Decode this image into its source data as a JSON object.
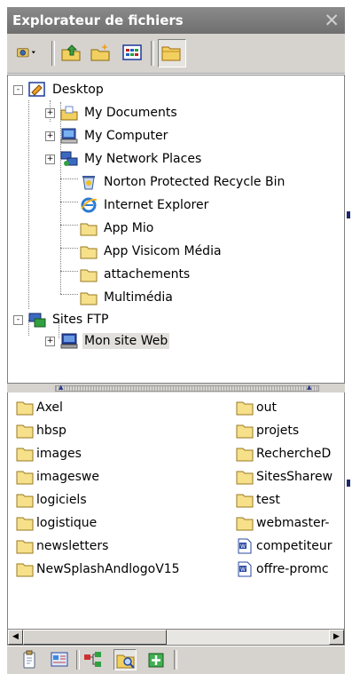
{
  "window": {
    "title": "Explorateur de fichiers",
    "close_glyph": "✕"
  },
  "toolbar": {
    "buttons": [
      {
        "name": "views-dropdown",
        "icon": "camera-icon"
      },
      {
        "name": "up-folder",
        "icon": "up-folder-icon"
      },
      {
        "name": "new-folder",
        "icon": "new-folder-icon"
      },
      {
        "name": "view-mode",
        "icon": "grid-view-icon"
      },
      {
        "name": "folders-toggle",
        "icon": "folder-icon",
        "pressed": true
      }
    ]
  },
  "tree": {
    "nodes": [
      {
        "label": "Desktop",
        "icon": "desktop-icon",
        "expander": "-"
      },
      {
        "label": "My Documents",
        "icon": "my-documents-icon",
        "expander": "+"
      },
      {
        "label": "My Computer",
        "icon": "my-computer-icon",
        "expander": "+"
      },
      {
        "label": "My Network Places",
        "icon": "network-icon",
        "expander": "+"
      },
      {
        "label": "Norton Protected Recycle Bin",
        "icon": "recycle-bin-icon"
      },
      {
        "label": "Internet Explorer",
        "icon": "internet-explorer-icon"
      },
      {
        "label": "App Mio",
        "icon": "folder-icon"
      },
      {
        "label": "App Visicom Média",
        "icon": "folder-icon"
      },
      {
        "label": "attachements",
        "icon": "folder-icon"
      },
      {
        "label": "Multimédia",
        "icon": "folder-icon"
      },
      {
        "label": "Sites FTP",
        "icon": "ftp-sites-icon",
        "expander": "-"
      },
      {
        "label": "Mon site Web",
        "icon": "server-icon",
        "expander": "+",
        "selected": true
      }
    ]
  },
  "file_list": {
    "left_column": [
      {
        "label": "Axel",
        "icon": "folder-icon"
      },
      {
        "label": "hbsp",
        "icon": "folder-icon"
      },
      {
        "label": "images",
        "icon": "folder-icon"
      },
      {
        "label": "imageswe",
        "icon": "folder-icon"
      },
      {
        "label": "logiciels",
        "icon": "folder-icon"
      },
      {
        "label": "logistique",
        "icon": "folder-icon"
      },
      {
        "label": "newsletters",
        "icon": "folder-icon"
      },
      {
        "label": "NewSplashAndlogoV15",
        "icon": "folder-icon"
      }
    ],
    "right_column": [
      {
        "label": "out",
        "icon": "folder-icon"
      },
      {
        "label": "projets",
        "icon": "folder-icon"
      },
      {
        "label": "RechercheD",
        "icon": "folder-icon"
      },
      {
        "label": "SitesSharew",
        "icon": "folder-icon"
      },
      {
        "label": "test",
        "icon": "folder-icon"
      },
      {
        "label": "webmaster-",
        "icon": "folder-icon"
      },
      {
        "label": "competiteur",
        "icon": "word-document-icon"
      },
      {
        "label": "offre-promc",
        "icon": "word-document-icon"
      }
    ]
  },
  "scrollbar": {
    "left_arrow": "◀",
    "right_arrow": "▶",
    "thumb_fraction": 0.47
  },
  "bottom_tabs": [
    {
      "name": "clipboard",
      "icon": "clipboard-icon"
    },
    {
      "name": "snippets",
      "icon": "snippets-icon"
    },
    {
      "name": "site-map",
      "icon": "site-map-icon"
    },
    {
      "name": "file-explorer",
      "icon": "folder-search-icon",
      "active": true
    },
    {
      "name": "add-ons",
      "icon": "plugin-icon"
    }
  ],
  "colors": {
    "titlebar": "#7c7c7c",
    "folder": "#f6e08a",
    "chrome": "#d6d3ce",
    "accent": "#1a2a6a"
  }
}
